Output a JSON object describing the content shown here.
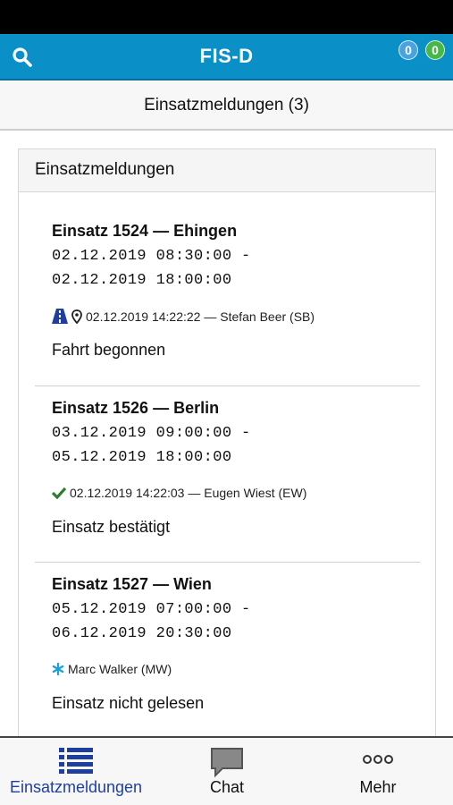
{
  "app": {
    "title": "FIS-D"
  },
  "badges": {
    "blue": "0",
    "green": "0"
  },
  "subheader": {
    "title": "Einsatzmeldungen (3)"
  },
  "panel": {
    "title": "Einsatzmeldungen"
  },
  "reports": [
    {
      "name": "Einsatz 1524 — Ehingen",
      "start": "02.12.2019 08:30:00 -",
      "end": "02.12.2019 18:00:00",
      "meta": "02.12.2019 14:22:22 — Stefan Beer (SB)",
      "status": "Fahrt begonnen",
      "icons": [
        "road-icon",
        "location-pin-icon"
      ]
    },
    {
      "name": "Einsatz 1526 — Berlin",
      "start": "03.12.2019 09:00:00 -",
      "end": "05.12.2019 18:00:00",
      "meta": "02.12.2019 14:22:03 — Eugen Wiest (EW)",
      "status": "Einsatz bestätigt",
      "icons": [
        "checkmark-icon"
      ]
    },
    {
      "name": "Einsatz 1527 — Wien",
      "start": "05.12.2019 07:00:00 -",
      "end": "06.12.2019 20:30:00",
      "meta": "Marc Walker (MW)",
      "status": "Einsatz nicht gelesen",
      "icons": [
        "asterisk-icon"
      ]
    }
  ],
  "nav": [
    {
      "label": "Einsatzmeldungen",
      "icon": "list-icon",
      "color": "#1e3fa0"
    },
    {
      "label": "Chat",
      "icon": "chat-bubble-icon",
      "color": "#111111"
    },
    {
      "label": "Mehr",
      "icon": "more-dots-icon",
      "color": "#111111"
    }
  ],
  "colors": {
    "appbar": "#0a8fc7",
    "accent": "#1e3fa0",
    "check": "#2e7d32",
    "asterisk": "#1aa0d8"
  }
}
